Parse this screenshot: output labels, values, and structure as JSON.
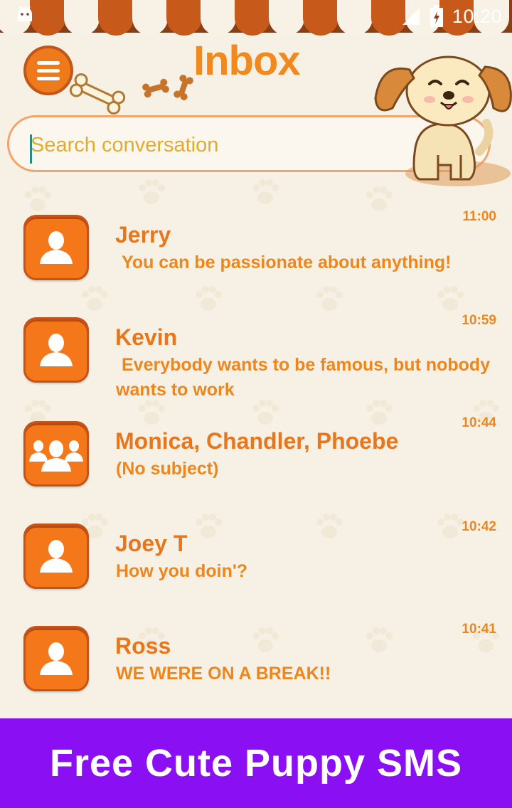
{
  "status_bar": {
    "time": "10:20"
  },
  "header": {
    "title": "Inbox",
    "menu_icon": "hamburger-icon"
  },
  "search": {
    "placeholder": "Search conversation",
    "value": ""
  },
  "conversations": [
    {
      "name": "Jerry",
      "snippet": "You can be passionate about anything!",
      "time": "11:00",
      "avatar": "single-contact-icon"
    },
    {
      "name": "Kevin",
      "snippet": "Everybody wants to be famous, but nobody wants to work",
      "time": "10:59",
      "avatar": "single-contact-icon"
    },
    {
      "name": "Monica, Chandler, Phoebe",
      "snippet": "(No subject)",
      "time": "10:44",
      "avatar": "group-contact-icon"
    },
    {
      "name": "Joey T",
      "snippet": "How you doin'?",
      "time": "10:42",
      "avatar": "single-contact-icon"
    },
    {
      "name": "Ross",
      "snippet": "WE WERE ON A BREAK!!",
      "time": "10:41",
      "avatar": "single-contact-icon"
    }
  ],
  "banner": {
    "text": "Free Cute Puppy SMS"
  },
  "colors": {
    "accent": "#f08a1e",
    "avatar_bg": "#f4781a",
    "banner_bg": "#8a0ff2",
    "awning_dark": "#8a3f12",
    "background": "#f6f1e4"
  }
}
